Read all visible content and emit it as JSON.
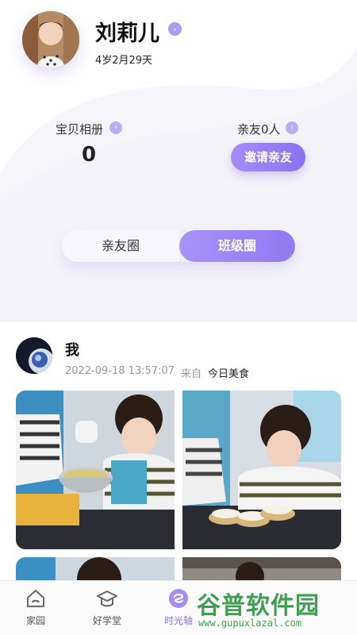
{
  "profile": {
    "name": "刘莉儿",
    "age": "4岁2月29天"
  },
  "stats": {
    "album_label": "宝贝相册",
    "album_count": "0",
    "friends_label": "亲友0人",
    "invite_label": "邀请亲友"
  },
  "segment": {
    "left_label": "亲友圈",
    "right_label": "班级圈",
    "selected": "班级圈"
  },
  "post": {
    "author": "我",
    "time": "2022-09-18 13:57:07",
    "from_label": "来自",
    "source": "今日美食"
  },
  "tabs": [
    {
      "label": "家园",
      "icon": "home-icon"
    },
    {
      "label": "好学堂",
      "icon": "graduation-cap-icon"
    },
    {
      "label": "时光轴",
      "icon": "timeline-icon"
    }
  ],
  "watermark": {
    "title": "谷普软件园",
    "url": "www.gupuxlazal.com"
  },
  "colors": {
    "accent": "#9079f2",
    "watermark": "#3f9e4f"
  }
}
